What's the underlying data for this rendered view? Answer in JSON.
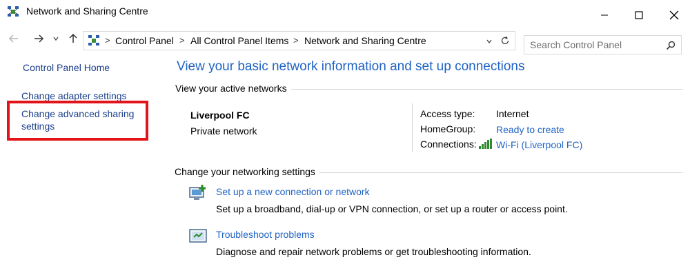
{
  "window": {
    "title": "Network and Sharing Centre",
    "minimize_glyph": "—",
    "maximize_glyph": "☐",
    "close_glyph": "✕"
  },
  "nav": {
    "back_glyph": "←",
    "forward_glyph": "→",
    "recent_glyph": "⌄",
    "up_glyph": "↑"
  },
  "address": {
    "breadcrumb": [
      "Control Panel",
      "All Control Panel Items",
      "Network and Sharing Centre"
    ],
    "separator": ">",
    "dropdown_glyph": "⌄",
    "refresh_glyph": "↻"
  },
  "search": {
    "placeholder": "Search Control Panel"
  },
  "sidebar": {
    "home": "Control Panel Home",
    "adapter": "Change adapter settings",
    "advanced_line1": "Change advanced sharing",
    "advanced_line2": "settings"
  },
  "main": {
    "heading": "View your basic network information and set up connections",
    "active_label": "View your active networks",
    "network_name": "Liverpool FC",
    "network_type": "Private network",
    "access_type_label": "Access type:",
    "access_type_value": "Internet",
    "homegroup_label": "HomeGroup:",
    "homegroup_value": "Ready to create",
    "connections_label": "Connections:",
    "connections_value": "Wi-Fi (Liverpool FC)",
    "change_label": "Change your networking settings",
    "setup_link": "Set up a new connection or network",
    "setup_desc": "Set up a broadband, dial-up or VPN connection, or set up a router or access point.",
    "trouble_link": "Troubleshoot problems",
    "trouble_desc": "Diagnose and repair network problems or get troubleshooting information."
  },
  "colors": {
    "link": "#1f63c4",
    "heading": "#1f63c4",
    "highlight": "#e3131a",
    "wifi_bars": "#2e8b2e"
  },
  "icons": [
    "network-sharing-icon",
    "minimize-icon",
    "maximize-icon",
    "close-icon",
    "back-icon",
    "forward-icon",
    "recent-locations-icon",
    "up-icon",
    "control-panel-icon",
    "dropdown-icon",
    "refresh-icon",
    "search-icon",
    "wifi-signal-icon",
    "new-connection-icon",
    "troubleshoot-icon"
  ]
}
